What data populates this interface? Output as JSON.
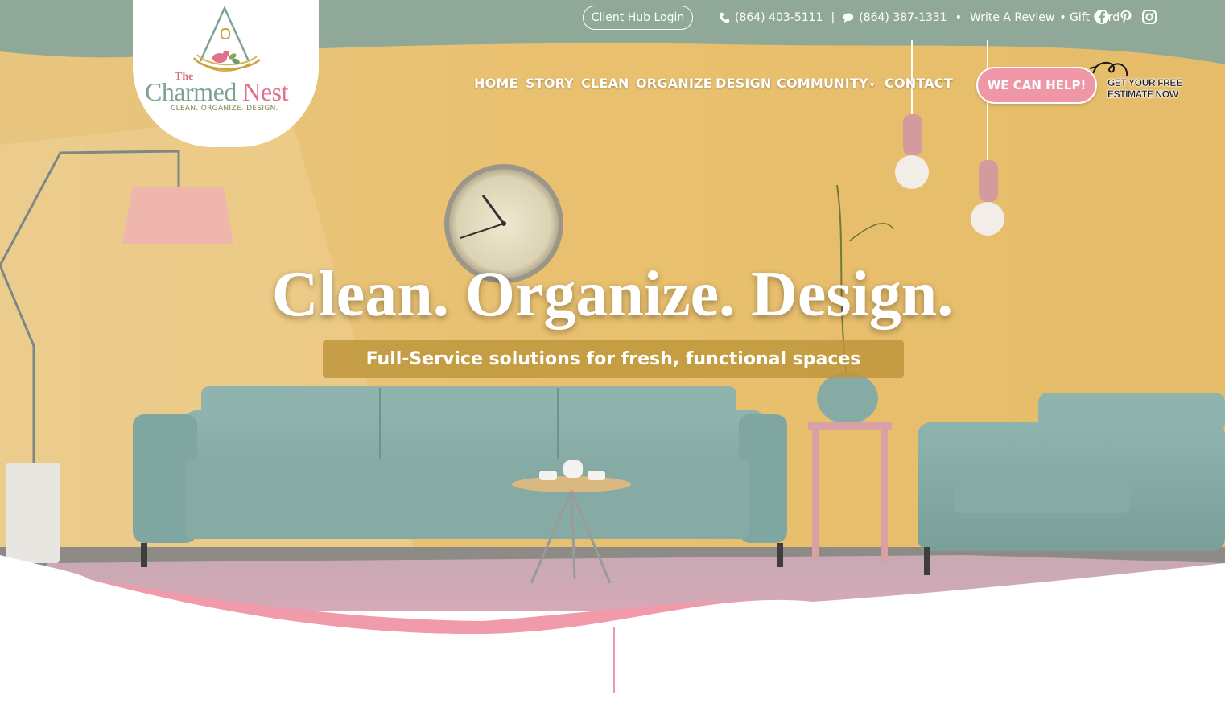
{
  "topbar": {
    "client_hub_label": "Client Hub Login",
    "phone_1": "(864) 403-5111",
    "divider": "|",
    "phone_2": "(864) 387-1331",
    "bullet": "•",
    "review_label": "Write A Review",
    "gift_label": "• Gift Card",
    "social_icons": [
      "facebook-icon",
      "pinterest-icon",
      "instagram-icon"
    ]
  },
  "logo": {
    "the": "The",
    "name_part1": "Charmed",
    "name_part2": "Nest",
    "tagline": "CLEAN. ORGANIZE. DESIGN."
  },
  "nav": {
    "items": [
      {
        "label": "HOME"
      },
      {
        "label": "STORY"
      },
      {
        "label": "CLEAN"
      },
      {
        "label": "ORGANIZE"
      },
      {
        "label": "DESIGN"
      },
      {
        "label": "COMMUNITY"
      },
      {
        "label": "CONTACT"
      }
    ],
    "cta_label": "WE CAN HELP!",
    "estimate_line1": "GET YOUR FREE",
    "estimate_line2": "ESTIMATE NOW"
  },
  "hero": {
    "headline": "Clean. Organize. Design.",
    "subline": "Full-Service solutions for fresh, functional spaces"
  },
  "colors": {
    "sage": "#8fa897",
    "wall": "#e9c378",
    "pink": "#ef97a7",
    "sofa": "#86aba5",
    "gold_banner": "#be963c"
  }
}
